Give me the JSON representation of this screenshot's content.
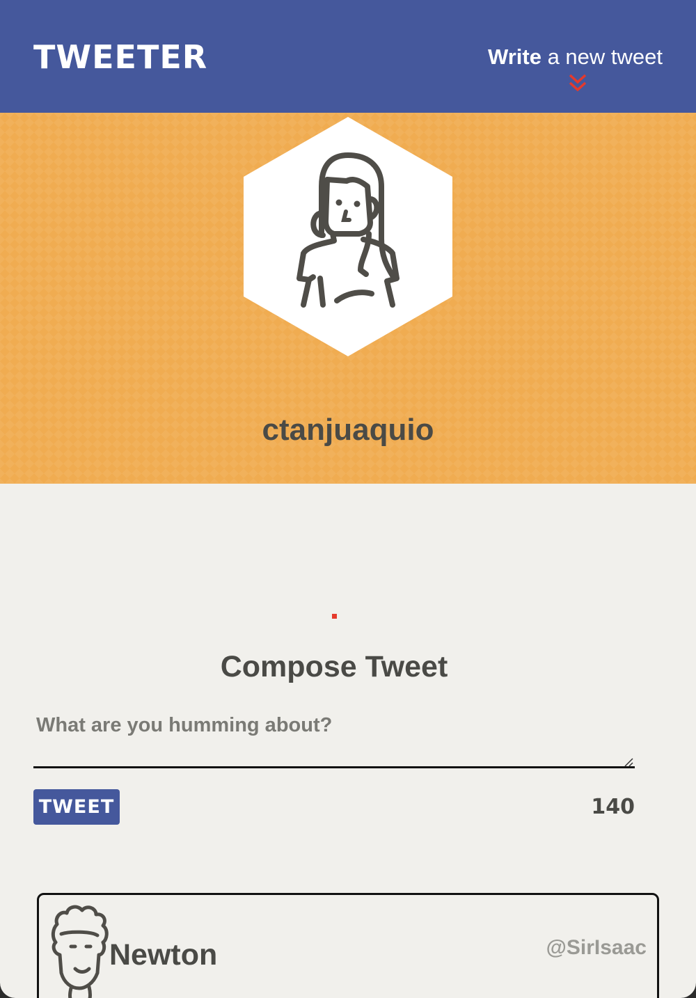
{
  "nav": {
    "logo": "TWEETER",
    "write_bold": "Write",
    "write_rest": " a new tweet",
    "chevron_icon": "double-chevron-down-icon",
    "chevron_color": "#e53a2c"
  },
  "profile": {
    "avatar_icon": "woman-long-hair-avatar-icon",
    "username": "ctanjuaquio"
  },
  "compose": {
    "title": "Compose Tweet",
    "placeholder": "What are you humming about?",
    "value": "",
    "button_label": "TWEET",
    "counter": "140"
  },
  "tweets": [
    {
      "avatar_icon": "curly-hair-man-avatar-icon",
      "name": "Newton",
      "handle": "@SirIsaac"
    }
  ],
  "colors": {
    "nav_bg": "#45589c",
    "header_bg": "#f0ac51",
    "page_bg": "#f1f0ec",
    "text_dark": "#4a4a46",
    "accent_red": "#e53a2c"
  }
}
